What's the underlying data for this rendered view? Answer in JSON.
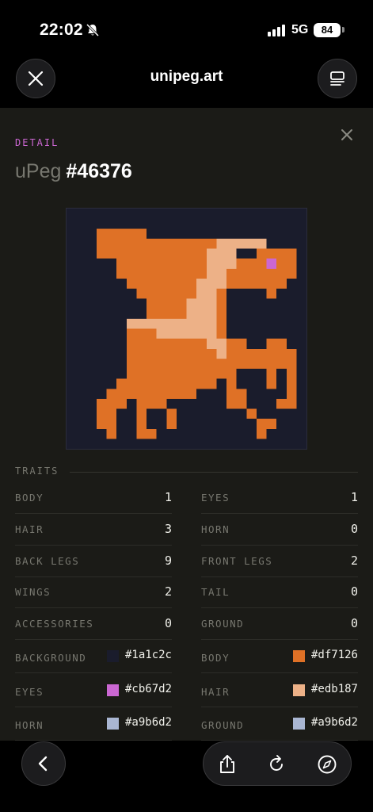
{
  "status_bar": {
    "time": "22:02",
    "network": "5G",
    "battery": "84"
  },
  "browser": {
    "title": "unipeg.art"
  },
  "detail": {
    "eyebrow": "DETAIL",
    "title_prefix": "uPeg",
    "title_number": "#46376"
  },
  "traits": {
    "section_label": "TRAITS",
    "numeric": [
      {
        "name": "BODY",
        "value": "1"
      },
      {
        "name": "EYES",
        "value": "1"
      },
      {
        "name": "HAIR",
        "value": "3"
      },
      {
        "name": "HORN",
        "value": "0"
      },
      {
        "name": "BACK LEGS",
        "value": "9"
      },
      {
        "name": "FRONT LEGS",
        "value": "2"
      },
      {
        "name": "WINGS",
        "value": "2"
      },
      {
        "name": "TAIL",
        "value": "0"
      },
      {
        "name": "ACCESSORIES",
        "value": "0"
      },
      {
        "name": "GROUND",
        "value": "0"
      }
    ],
    "colors": [
      {
        "name": "BACKGROUND",
        "value": "#1a1c2c"
      },
      {
        "name": "BODY",
        "value": "#df7126"
      },
      {
        "name": "EYES",
        "value": "#cb67d2"
      },
      {
        "name": "HAIR",
        "value": "#edb187"
      },
      {
        "name": "HORN",
        "value": "#a9b6d2"
      },
      {
        "name": "GROUND",
        "value": "#a9b6d2"
      }
    ]
  },
  "icons": {
    "close": "close-icon",
    "menu": "tabs-icon",
    "back": "chevron-left-icon",
    "share": "share-icon",
    "reload": "reload-icon",
    "compass": "compass-icon"
  },
  "colors": {
    "accent": "#cb67d2",
    "page_background": "#1b1b17",
    "artwork_background": "#1a1c2c",
    "body": "#df7126",
    "hair": "#edb187",
    "eyes": "#cb67d2"
  }
}
